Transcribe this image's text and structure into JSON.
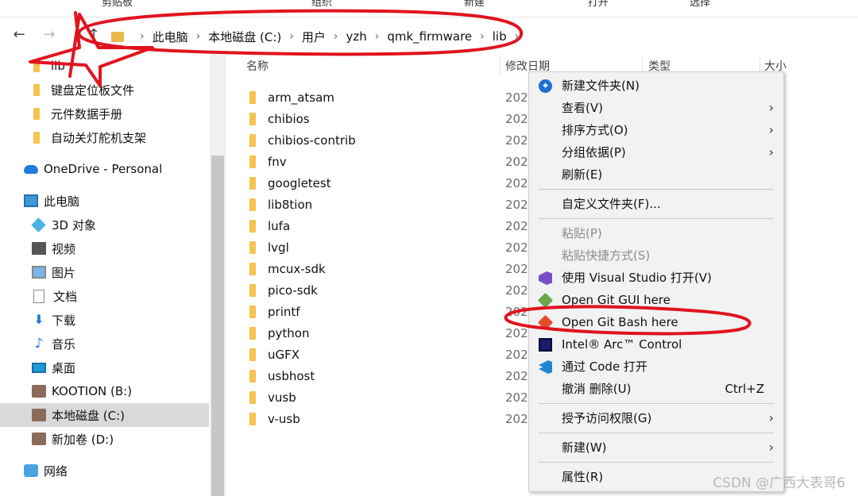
{
  "ribbon": {
    "items": [
      "剪贴板",
      "组织",
      "新建",
      "打开",
      "选择"
    ]
  },
  "breadcrumb": {
    "items": [
      "此电脑",
      "本地磁盘 (C:)",
      "用户",
      "yzh",
      "qmk_firmware",
      "lib"
    ],
    "separator": "›"
  },
  "sidebar": {
    "items": [
      {
        "label": "lib",
        "icon": "folder-icon"
      },
      {
        "label": "键盘定位板文件",
        "icon": "folder-icon"
      },
      {
        "label": "元件数据手册",
        "icon": "folder-icon"
      },
      {
        "label": "自动关灯舵机支架",
        "icon": "folder-icon"
      },
      {
        "label": "OneDrive - Personal",
        "icon": "cloud-icon"
      },
      {
        "label": "此电脑",
        "icon": "computer-icon"
      },
      {
        "label": "3D 对象",
        "icon": "cube-icon"
      },
      {
        "label": "视频",
        "icon": "video-icon"
      },
      {
        "label": "图片",
        "icon": "picture-icon"
      },
      {
        "label": "文档",
        "icon": "document-icon"
      },
      {
        "label": "下载",
        "icon": "download-icon"
      },
      {
        "label": "音乐",
        "icon": "music-icon"
      },
      {
        "label": "桌面",
        "icon": "desktop-icon"
      },
      {
        "label": "KOOTION (B:)",
        "icon": "drive-icon"
      },
      {
        "label": "本地磁盘 (C:)",
        "icon": "drive-icon"
      },
      {
        "label": "新加卷 (D:)",
        "icon": "drive-icon"
      },
      {
        "label": "网络",
        "icon": "network-icon"
      }
    ]
  },
  "columns": {
    "name": "名称",
    "modified": "修改日期",
    "type": "类型",
    "size": "大小"
  },
  "files": [
    {
      "name": "arm_atsam",
      "date": "202"
    },
    {
      "name": "chibios",
      "date": "202"
    },
    {
      "name": "chibios-contrib",
      "date": "202"
    },
    {
      "name": "fnv",
      "date": "202"
    },
    {
      "name": "googletest",
      "date": "202"
    },
    {
      "name": "lib8tion",
      "date": "202"
    },
    {
      "name": "lufa",
      "date": "202"
    },
    {
      "name": "lvgl",
      "date": "202"
    },
    {
      "name": "mcux-sdk",
      "date": "202"
    },
    {
      "name": "pico-sdk",
      "date": "202"
    },
    {
      "name": "printf",
      "date": "202"
    },
    {
      "name": "python",
      "date": "202"
    },
    {
      "name": "uGFX",
      "date": "202"
    },
    {
      "name": "usbhost",
      "date": "202"
    },
    {
      "name": "vusb",
      "date": "202"
    },
    {
      "name": "v-usb",
      "date": "202"
    }
  ],
  "context_menu": {
    "items": [
      {
        "label": "新建文件夹(N)",
        "icon": "new-folder-icon"
      },
      {
        "label": "查看(V)",
        "submenu": true
      },
      {
        "label": "排序方式(O)",
        "submenu": true
      },
      {
        "label": "分组依据(P)",
        "submenu": true
      },
      {
        "label": "刷新(E)"
      },
      {
        "label": "自定义文件夹(F)..."
      },
      {
        "label": "粘贴(P)",
        "disabled": true
      },
      {
        "label": "粘贴快捷方式(S)",
        "disabled": true
      },
      {
        "label": "使用 Visual Studio 打开(V)",
        "icon": "visual-studio-icon"
      },
      {
        "label": "Open Git GUI here",
        "icon": "git-gui-icon"
      },
      {
        "label": "Open Git Bash here",
        "icon": "git-bash-icon"
      },
      {
        "label": "Intel® Arc™ Control",
        "icon": "intel-arc-icon"
      },
      {
        "label": "通过 Code 打开",
        "icon": "vscode-icon"
      },
      {
        "label": "撤消 删除(U)",
        "shortcut": "Ctrl+Z"
      },
      {
        "label": "授予访问权限(G)",
        "submenu": true
      },
      {
        "label": "新建(W)",
        "submenu": true
      },
      {
        "label": "属性(R)"
      }
    ],
    "submenu_arrow": "›"
  },
  "watermark": "CSDN @广西大表哥6",
  "colors": {
    "annotation_red": "#e0141e",
    "folder_yellow": "#f3c44f",
    "selection_gray": "#d9d9d9",
    "menu_bg": "#f2f2f2"
  }
}
